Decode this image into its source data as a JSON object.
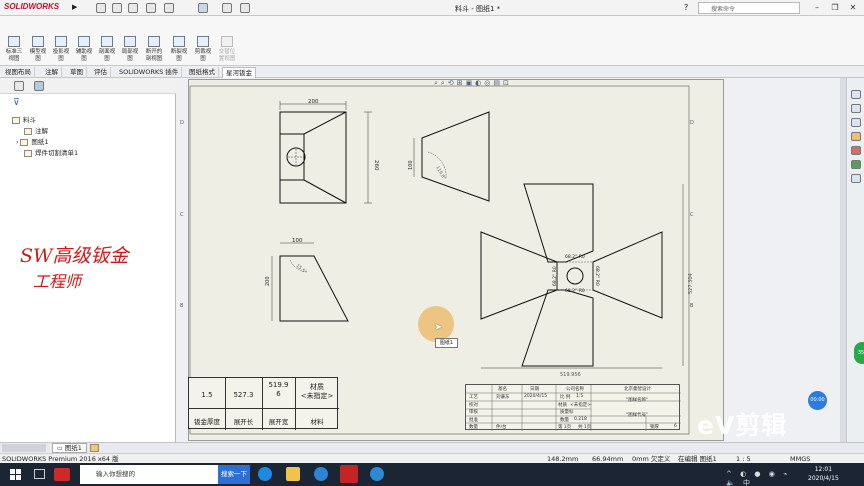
{
  "app": {
    "logo": "SOLIDWORKS",
    "document_title": "料斗 - 图纸1 *",
    "search_placeholder": "搜索命令"
  },
  "ribbon": {
    "buttons": [
      {
        "label": "标准三\n视图",
        "enabled": true
      },
      {
        "label": "模型视\n图",
        "enabled": true
      },
      {
        "label": "投影视\n图",
        "enabled": true
      },
      {
        "label": "辅助视\n图",
        "enabled": true
      },
      {
        "label": "剖面视\n图",
        "enabled": true
      },
      {
        "label": "局部视\n图",
        "enabled": true
      },
      {
        "label": "断开的\n剖视图",
        "enabled": true
      },
      {
        "label": "断裂视\n图",
        "enabled": true
      },
      {
        "label": "剪裁视\n图",
        "enabled": true
      },
      {
        "label": "交替位\n置视图",
        "enabled": false
      }
    ]
  },
  "tabs": [
    "视图布局",
    "注解",
    "草图",
    "评估",
    "SOLIDWORKS 插件",
    "图纸格式",
    "星河钣金"
  ],
  "active_tab": "星河钣金",
  "tree": {
    "root": "料斗",
    "items": [
      "注解",
      "图纸1",
      "焊件切割清单1"
    ]
  },
  "watermark": {
    "line1": "SW高级钣金",
    "line2": "工程师"
  },
  "drawing": {
    "dims": {
      "top_width": "200",
      "top_height": "260",
      "side_height": "100",
      "side_angle": "119.8°",
      "front_width": "100",
      "front_height": "200",
      "front_angle": "15.5°",
      "flat_width": "519.956",
      "flat_height": "527.304",
      "flat_r1": "68.2° R0",
      "flat_r2": "68.2° R0",
      "flat_r3": "68.2° R0",
      "flat_r4": "68.2° R0"
    },
    "matrix": {
      "values": [
        "1.5",
        "527.3",
        "519.9\n6",
        "材质\n<未指定>"
      ],
      "labels": [
        "钣金厚度",
        "展开长",
        "展开宽",
        "材料"
      ]
    },
    "titleblock": {
      "h1": "基名",
      "h2": "日期",
      "h3": "公司名称",
      "h4": "北京曼智设计",
      "r1": "工艺",
      "r1b": "刘谦东",
      "r1c": "2020/4/15",
      "r1d": "比 例",
      "r1e": "1:5",
      "r1f": "\"图样名称\"",
      "r2": "校对",
      "r2d": "材质",
      "r2e": "<未指定>",
      "r3": "审核",
      "r3d": "质量标",
      "r4": "批准",
      "r4d": "数量",
      "r4e": "0.218",
      "r4f": "\"图样代号\"",
      "r5": "数量",
      "r5b": "件/台",
      "r5d": "第 1页",
      "r5e": "共 1页",
      "r5f": "钢厚",
      "r5g": "6"
    },
    "tooltip": "图纸1"
  },
  "sheet_tab": "图纸1",
  "status": {
    "app": "SOLIDWORKS Premium 2016 x64 版",
    "x": "148.2mm",
    "y": "66.94mm",
    "z": "0mm 欠定义",
    "editing": "在编辑 图纸1",
    "scale": "1 : 5",
    "units": "MMGS"
  },
  "taskbar": {
    "search_placeholder": "输入你想搜的",
    "search_button": "搜索一下",
    "time": "12:01",
    "date": "2020/4/15"
  },
  "overlay": {
    "ev_logo": "eV剪辑",
    "ev_badge": "00:00",
    "green_badge": "35"
  }
}
